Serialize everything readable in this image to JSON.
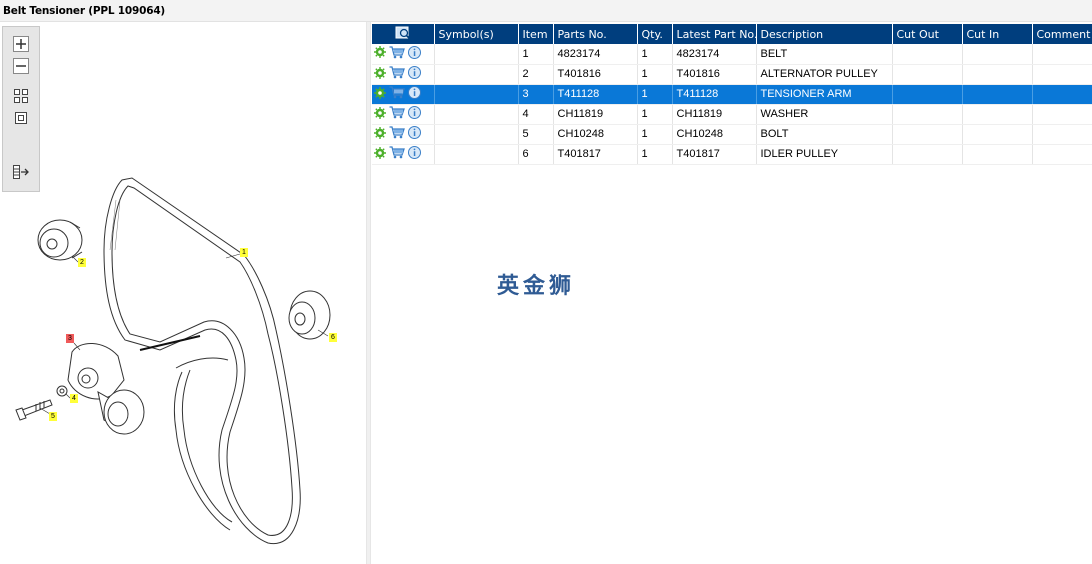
{
  "window": {
    "title": "Belt Tensioner (PPL 109064)"
  },
  "toolbar": {
    "buttons": [
      {
        "name": "zoom-in-icon"
      },
      {
        "name": "zoom-out-icon"
      },
      {
        "name": "fit-all-icon"
      },
      {
        "name": "fit-page-icon"
      },
      {
        "name": "export-list-icon"
      }
    ]
  },
  "diagram": {
    "callouts": [
      "1",
      "2",
      "3",
      "4",
      "5",
      "6"
    ]
  },
  "table": {
    "headers": [
      "",
      "Symbol(s)",
      "Item",
      "Parts No.",
      "Qty.",
      "Latest Part No.",
      "Description",
      "Cut Out",
      "Cut In",
      "Comment"
    ],
    "rows": [
      {
        "item": "1",
        "part_no": "4823174",
        "qty": "1",
        "latest": "4823174",
        "desc": "BELT",
        "selected": false
      },
      {
        "item": "2",
        "part_no": "T401816",
        "qty": "1",
        "latest": "T401816",
        "desc": "ALTERNATOR PULLEY",
        "selected": false
      },
      {
        "item": "3",
        "part_no": "T411128",
        "qty": "1",
        "latest": "T411128",
        "desc": "TENSIONER ARM",
        "selected": true
      },
      {
        "item": "4",
        "part_no": "CH11819",
        "qty": "1",
        "latest": "CH11819",
        "desc": "WASHER",
        "selected": false
      },
      {
        "item": "5",
        "part_no": "CH10248",
        "qty": "1",
        "latest": "CH10248",
        "desc": "BOLT",
        "selected": false
      },
      {
        "item": "6",
        "part_no": "T401817",
        "qty": "1",
        "latest": "T401817",
        "desc": "IDLER PULLEY",
        "selected": false
      }
    ]
  },
  "watermark": "英金狮",
  "colors": {
    "header_bg": "#003e7e",
    "selected_row": "#0a78d7",
    "accent_green": "#4caf2a",
    "cart_blue": "#3a7fc8"
  }
}
